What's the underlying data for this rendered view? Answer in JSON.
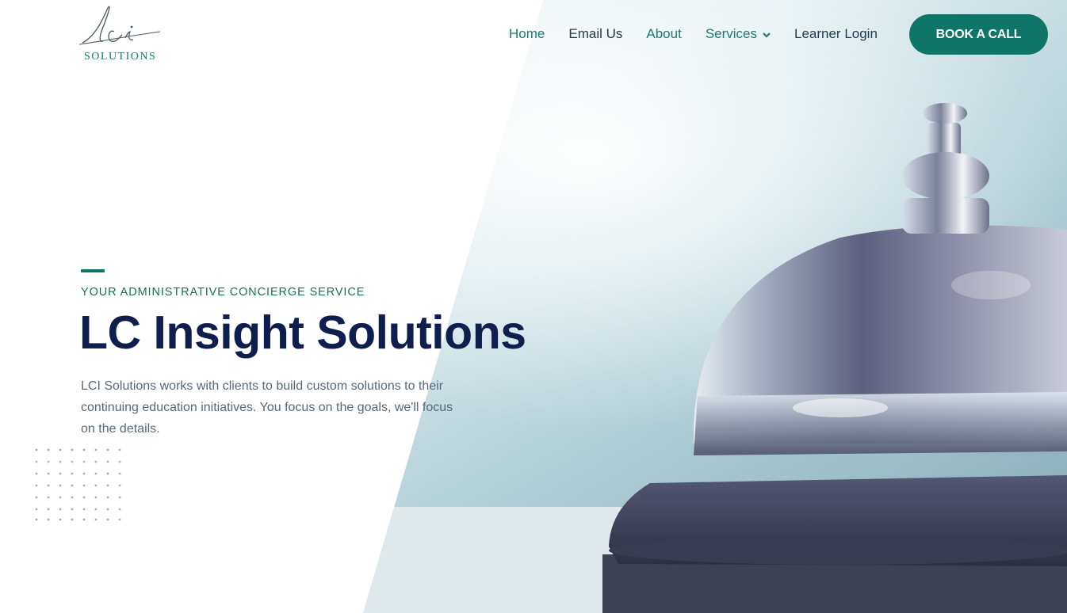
{
  "brand": {
    "logo_script": "lci",
    "logo_word": "SOLUTIONS"
  },
  "nav": {
    "items": [
      {
        "label": "Home"
      },
      {
        "label": "Email Us"
      },
      {
        "label": "About"
      },
      {
        "label": "Services"
      },
      {
        "label": "Learner Login"
      }
    ],
    "cta_label": "BOOK A CALL"
  },
  "hero": {
    "eyebrow": "YOUR ADMINISTRATIVE CONCIERGE SERVICE",
    "title": "LC Insight Solutions",
    "body": "LCI Solutions works with clients to build custom solutions to their continuing education initiatives. You focus on the goals, we'll focus on the details.",
    "image_subject": "service-bell"
  },
  "colors": {
    "accent": "#0f7566",
    "heading": "#0e1f4f",
    "body": "#56687a",
    "nav_text": "#1e3a4a"
  }
}
